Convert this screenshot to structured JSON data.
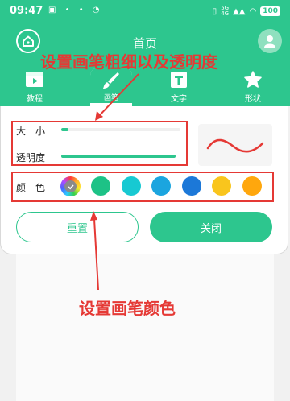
{
  "status_bar": {
    "time": "09:47",
    "network_top": "5G",
    "network_bottom": "4G",
    "battery": "100"
  },
  "header": {
    "title": "首页",
    "home_icon": "home-icon",
    "user_icon": "user-icon",
    "accent_color": "#2dc68e"
  },
  "tabs": [
    {
      "label": "教程",
      "icon": "play-icon"
    },
    {
      "label": "画笔",
      "icon": "brush-icon",
      "active": true
    },
    {
      "label": "文字",
      "icon": "text-icon"
    },
    {
      "label": "形状",
      "icon": "star-icon"
    }
  ],
  "sliders": {
    "size_label": "大　小",
    "size_value_fraction": 0.06,
    "opacity_label": "透明度",
    "opacity_value_fraction": 1.0
  },
  "colors": {
    "label": "颜　色",
    "custom_picker_icon": "color-wheel-icon",
    "swatches": [
      "#1dc286",
      "#17c9d2",
      "#1ba5df",
      "#1c78d8",
      "#f9c51d",
      "#ffa70d"
    ]
  },
  "buttons": {
    "reset": "重置",
    "close": "关闭"
  },
  "annotations": {
    "top": "设置画笔粗细以及透明度",
    "bottom": "设置画笔颜色",
    "color": "#e53935"
  }
}
